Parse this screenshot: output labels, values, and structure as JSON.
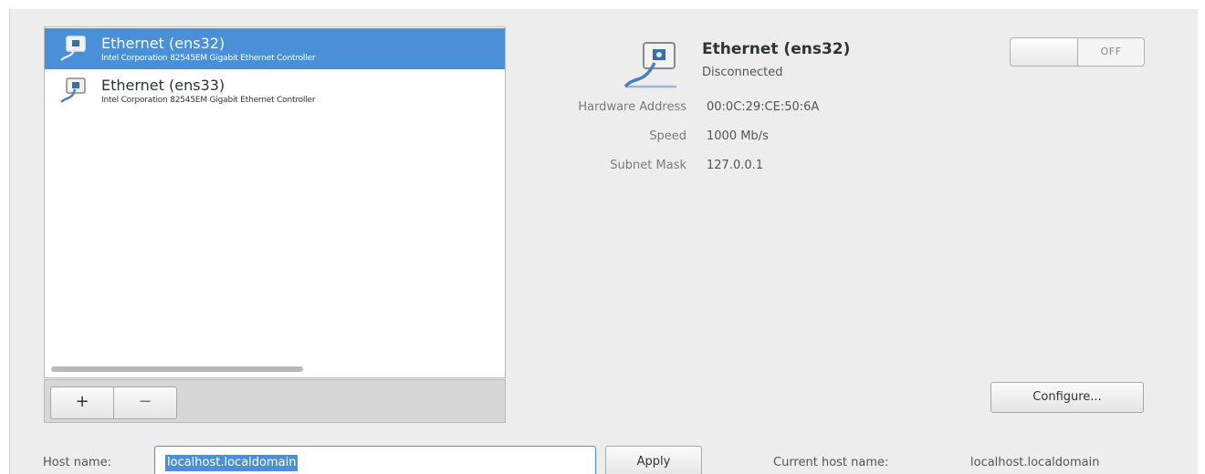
{
  "devices": [
    {
      "name": "Ethernet (ens32)",
      "description": "Intel Corporation 82545EM Gigabit Ethernet Controller",
      "selected": true
    },
    {
      "name": "Ethernet (ens33)",
      "description": "Intel Corporation 82545EM Gigabit Ethernet Controller",
      "selected": false
    }
  ],
  "list_toolbar": {
    "add_label": "+",
    "remove_label": "−"
  },
  "details": {
    "name": "Ethernet (ens32)",
    "status": "Disconnected",
    "switch_label": "OFF",
    "properties": [
      {
        "label": "Hardware Address",
        "value": "00:0C:29:CE:50:6A"
      },
      {
        "label": "Speed",
        "value": "1000 Mb/s"
      },
      {
        "label": "Subnet Mask",
        "value": "127.0.0.1"
      }
    ],
    "configure_label": "Configure..."
  },
  "hostname": {
    "label": "Host name:",
    "value": "localhost.localdomain",
    "apply_label": "Apply",
    "current_label": "Current host name:",
    "current_value": "localhost.localdomain"
  },
  "icons": {
    "device": "ethernet-cable-icon"
  },
  "colors": {
    "selection": "#4a90d9",
    "window_bg": "#ededed"
  }
}
